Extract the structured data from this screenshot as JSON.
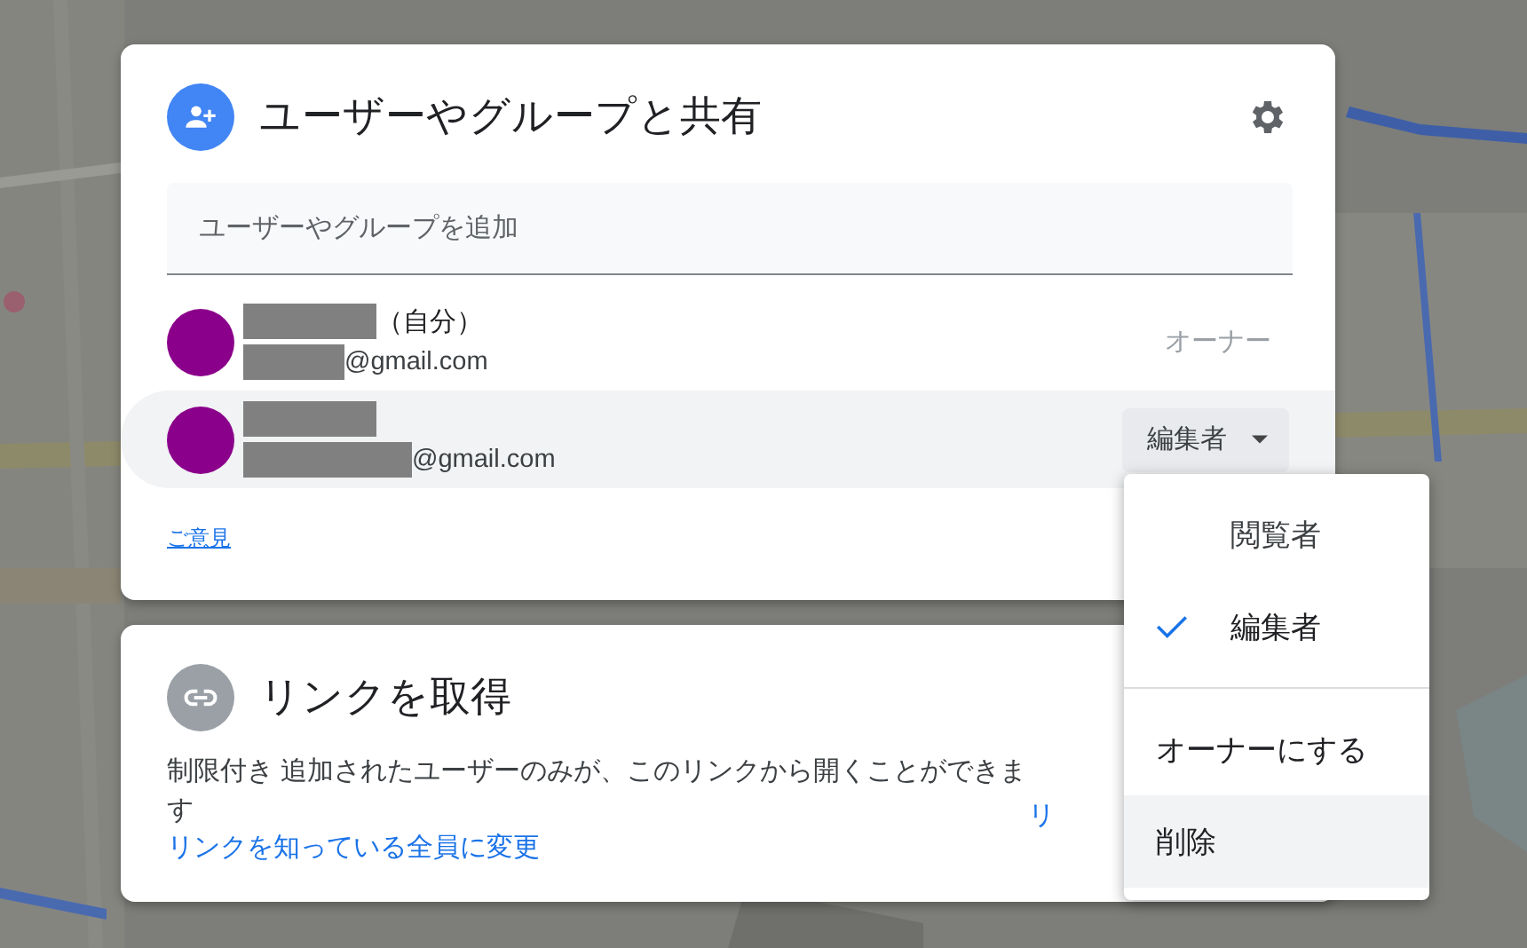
{
  "share_dialog": {
    "title": "ユーザーやグループと共有",
    "add_field": {
      "placeholder": "ユーザーやグループを追加"
    },
    "members": [
      {
        "name_suffix": "（自分）",
        "email": "@gmail.com",
        "role": "オーナー",
        "kind": "owner",
        "highlighted": false
      },
      {
        "email": "@gmail.com",
        "role": "編集者",
        "kind": "editable",
        "highlighted": true
      }
    ],
    "feedback_link": "ご意見"
  },
  "link_card": {
    "title": "リンクを取得",
    "description": "制限付き 追加されたユーザーのみが、このリンクから開くことができます",
    "change_link": "リンクを知っている全員に変更",
    "copy_link": "リ"
  },
  "role_menu": {
    "items": [
      {
        "label": "閲覧者",
        "kind": "role",
        "selected": false,
        "highlighted": false
      },
      {
        "label": "編集者",
        "kind": "role",
        "selected": true,
        "highlighted": false
      },
      {
        "label": "オーナーにする",
        "kind": "action",
        "highlighted": false
      },
      {
        "label": "削除",
        "kind": "action",
        "highlighted": true
      }
    ]
  }
}
